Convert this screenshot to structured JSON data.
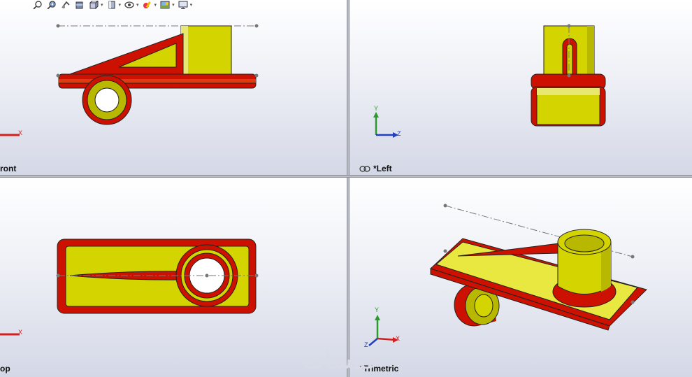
{
  "toolbar": {
    "buttons": [
      {
        "icon": "zoom-to-fit-icon"
      },
      {
        "icon": "zoom-area-icon"
      },
      {
        "icon": "previous-view-icon"
      },
      {
        "icon": "section-view-icon"
      },
      {
        "icon": "view-orientation-icon"
      },
      {
        "icon": "display-style-icon"
      },
      {
        "icon": "hide-show-items-icon"
      },
      {
        "icon": "edit-appearance-icon"
      },
      {
        "icon": "apply-scene-icon"
      },
      {
        "icon": "view-settings-icon"
      }
    ]
  },
  "viewports": {
    "front": {
      "label": "ront"
    },
    "left": {
      "label": "*Left"
    },
    "top": {
      "label": "op"
    },
    "trimetric": {
      "label": "*Trimetric"
    }
  },
  "axes": {
    "x": "X",
    "y": "Y",
    "z": "Z"
  },
  "watermark": "خمسات",
  "colors": {
    "part_face": "#d4d400",
    "part_edge": "#cc1100",
    "x_axis": "#d02020",
    "y_axis": "#2a9a2a",
    "z_axis": "#2040c0"
  }
}
